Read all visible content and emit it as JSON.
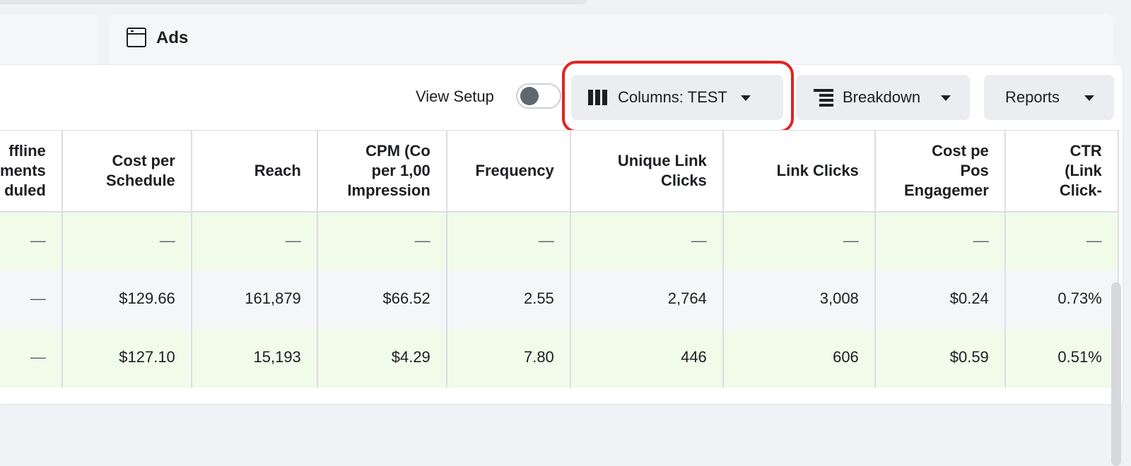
{
  "header": {
    "ads_title": "Ads"
  },
  "toolbar": {
    "view_setup_label": "View Setup",
    "columns_label": "Columns: TEST",
    "breakdown_label": "Breakdown",
    "reports_label": "Reports"
  },
  "table": {
    "columns": [
      "ffline\nments\nduled",
      "Cost per\nSchedule",
      "Reach",
      "CPM (Co\nper 1,00\nImpression",
      "Frequency",
      "Unique Link\nClicks",
      "Link Clicks",
      "Cost pe\nPos\nEngagemer",
      "CTR\n(Link\nClick-"
    ],
    "rows": [
      [
        "—",
        "—",
        "—",
        "—",
        "—",
        "—",
        "—",
        "—",
        "—"
      ],
      [
        "—",
        "$129.66",
        "161,879",
        "$66.52",
        "2.55",
        "2,764",
        "3,008",
        "$0.24",
        "0.73%"
      ],
      [
        "—",
        "$127.10",
        "15,193",
        "$4.29",
        "7.80",
        "446",
        "606",
        "$0.59",
        "0.51%"
      ]
    ]
  },
  "colors": {
    "highlight": "#e02424",
    "row_green": "#f1fbe9",
    "row_grey": "#f5f6f7"
  },
  "icons": {
    "ads": "ads-window-icon",
    "columns": "columns-icon",
    "breakdown": "breakdown-icon"
  }
}
